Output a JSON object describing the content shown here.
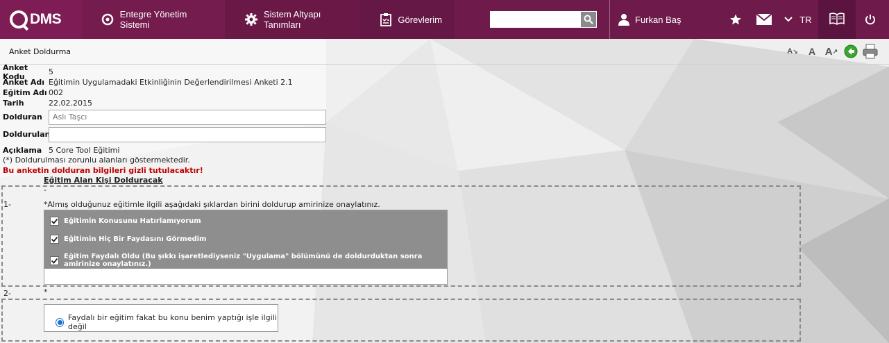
{
  "topbar": {
    "logo_text": "DMS",
    "nav": [
      {
        "label": "Entegre Yönetim Sistemi",
        "icon": "q-circle-icon"
      },
      {
        "label": "Sistem Altyapı Tanımları",
        "icon": "gear-icon"
      },
      {
        "label": "Görevlerim",
        "icon": "clipboard-icon"
      }
    ],
    "search": {
      "value": "",
      "placeholder": ""
    },
    "user_name": "Furkan Baş",
    "language": "TR",
    "accent_color": "#6e1a4a"
  },
  "page": {
    "title": "Anket Doldurma",
    "tools": [
      "font-decrease-icon",
      "font-reset-icon",
      "font-increase-icon",
      "back-icon",
      "print-icon"
    ]
  },
  "form": {
    "fields": [
      {
        "label": "Anket Kodu",
        "value": "5"
      },
      {
        "label": "Anket Adı",
        "value": "Eğitimin Uygulamadaki Etkinliğinin Değerlendirilmesi Anketi 2.1"
      },
      {
        "label": "Eğitim Adı",
        "value": "002"
      },
      {
        "label": "Tarih",
        "value": "22.02.2015"
      }
    ],
    "dolduran": {
      "label": "Dolduran",
      "placeholder": "Aslı Taşcı",
      "value": ""
    },
    "doldurulan": {
      "label": "Doldurulan",
      "placeholder": "",
      "value": ""
    },
    "aciklama": {
      "label": "Açıklama",
      "value": "5 Core Tool Eğitimi"
    },
    "required_note": "(*) Doldurulması zorunlu alanları göstermektedir.",
    "warning": "Bu anketin dolduran bilgileri gizli tutulacaktır!",
    "warning_color": "#c00000"
  },
  "survey": {
    "section_title": "Eğitim Alan Kişi Dolduracak",
    "section_dash": "-",
    "questions": [
      {
        "number": "1-",
        "text": "*Almış olduğunuz eğitimle ilgili aşağıdaki şıklardan birini doldurup amirinize onaylatınız.",
        "options": [
          {
            "label": "Eğitimin Konusunu Hatırlamıyorum",
            "checked": true
          },
          {
            "label": "Eğitimin Hiç Bir Faydasını Görmedim",
            "checked": true
          },
          {
            "label": "Eğitim Faydalı Oldu (Bu şıkkı işaretlediyseniz \"Uygulama\" bölümünü de doldurduktan sonra amirinize onaylatınız.)",
            "checked": true
          }
        ]
      },
      {
        "number": "2-",
        "text": "*",
        "options": [
          {
            "label": "Faydalı bir eğitim fakat bu konu benim yaptığı işle ilgili değil",
            "selected": true
          }
        ]
      }
    ]
  }
}
